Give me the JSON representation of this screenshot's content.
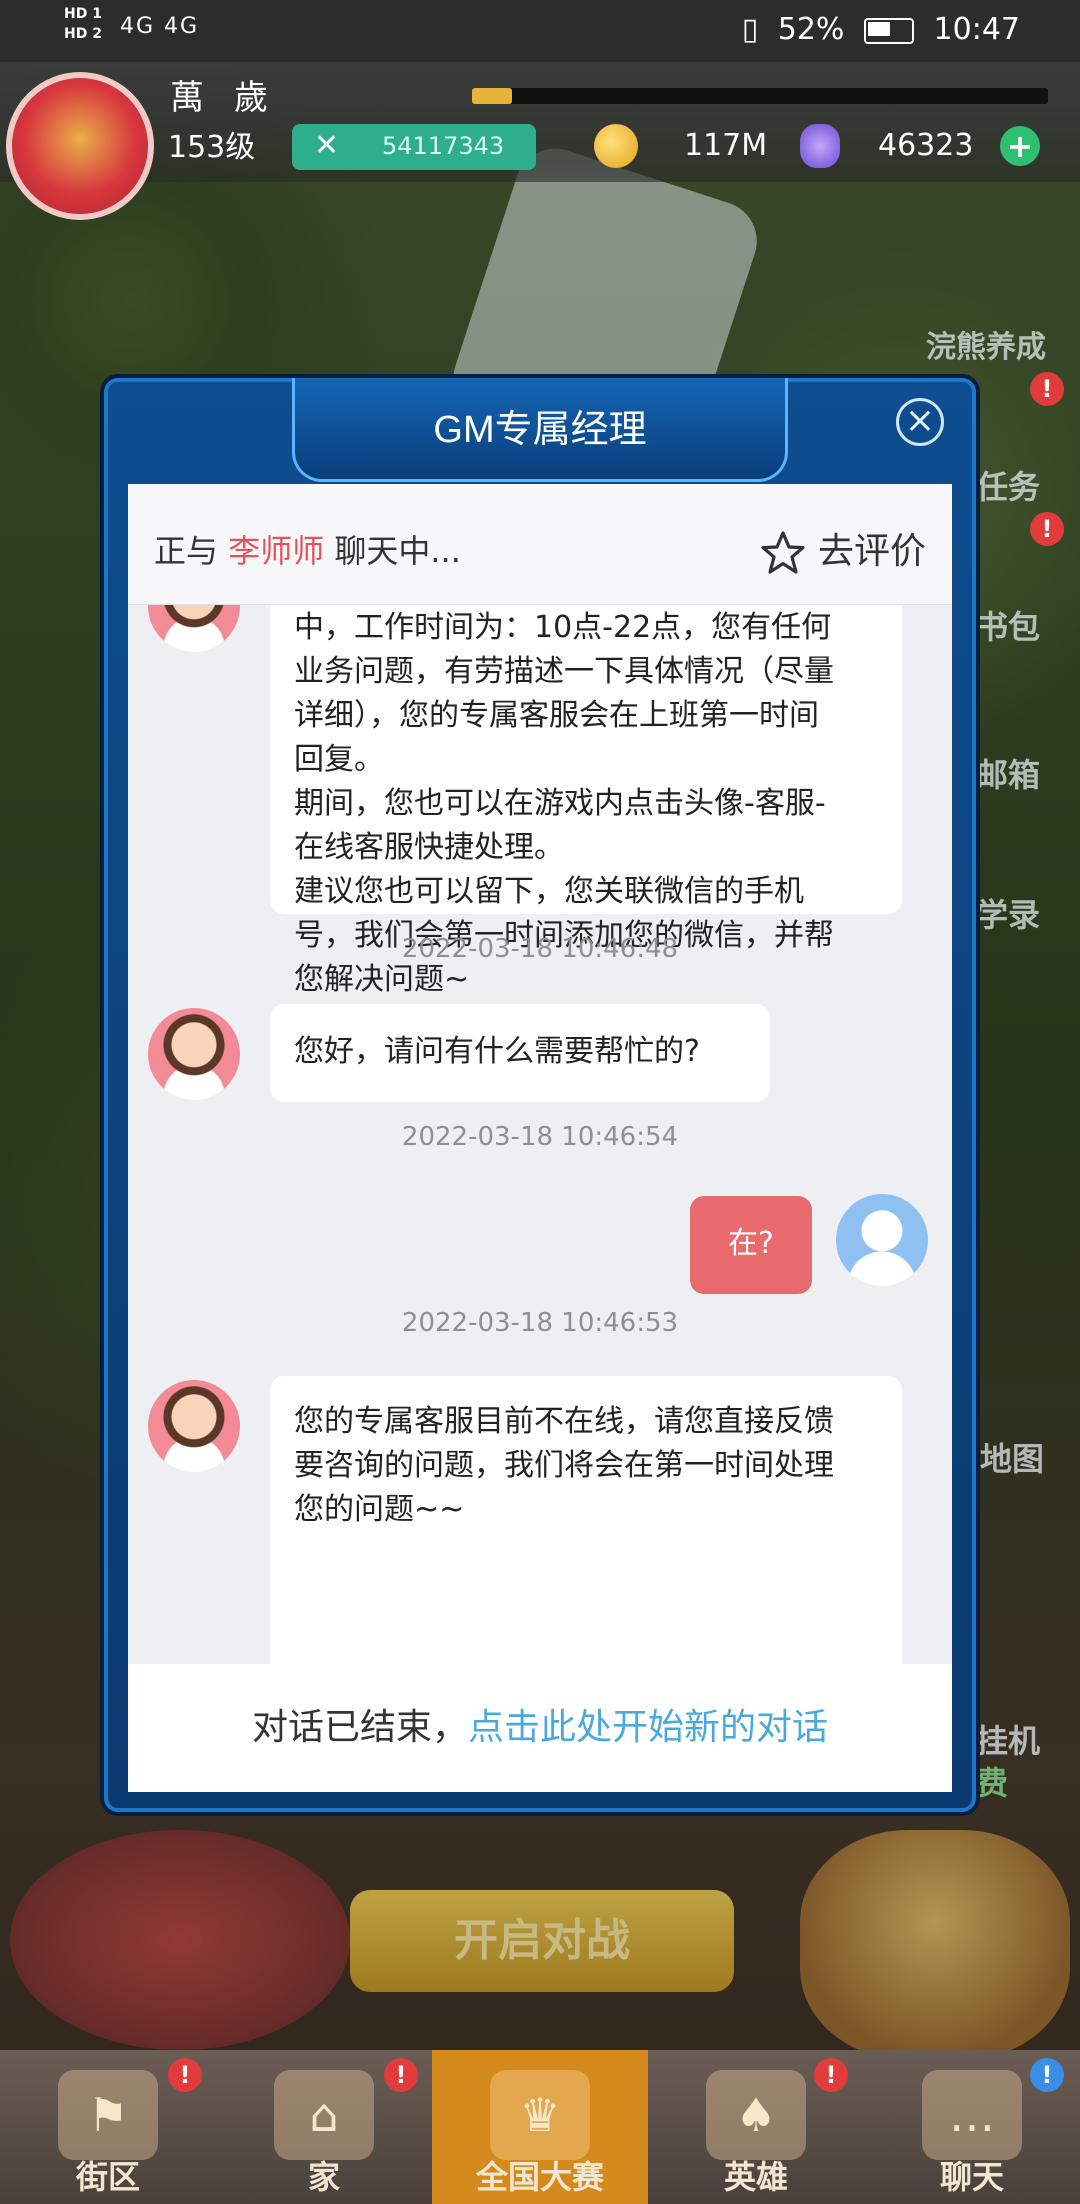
{
  "status_bar": {
    "sim_labels": [
      "HD 1",
      "HD 2"
    ],
    "signals": "4G 4G",
    "battery": "52%",
    "time": "10:47"
  },
  "hud": {
    "title": "萬歲",
    "level": "153级",
    "power": "54117343",
    "coins": "117M",
    "gems": "46323"
  },
  "side_menu": {
    "raccoon": "浣熊养成",
    "task": "任务",
    "bag": "书包",
    "mail": "邮箱",
    "study": "学录",
    "map": "地图",
    "idle": "挂机",
    "free": "费"
  },
  "dialog": {
    "title": "GM专属经理",
    "chat_with_prefix": "正与",
    "agent_name": "李师师",
    "chat_with_suffix": "聊天中...",
    "rate_label": "去评价",
    "footer_ended": "对话已结束，",
    "footer_link": "点击此处开始新的对话"
  },
  "messages": {
    "m1_lines": [
      "中，工作时间为：10点-22点，您有任何",
      "业务问题，有劳描述一下具体情况（尽量",
      "详细），您的专属客服会在上班第一时间",
      "回复。",
      "期间，您也可以在游戏内点击头像-客服-",
      "在线客服快捷处理。",
      "建议您也可以留下，您关联微信的手机",
      "号，我们会第一时间添加您的微信，并帮",
      "您解决问题~"
    ],
    "ts1": "2022-03-18 10:46:48",
    "m2": "您好，请问有什么需要帮忙的?",
    "ts2": "2022-03-18 10:46:54",
    "m3": "在?",
    "ts3": "2022-03-18 10:46:53",
    "m4_lines": [
      "您的专属客服目前不在线，请您直接反馈",
      "要咨询的问题，我们将会在第一时间处理",
      "您的问题~~"
    ]
  },
  "game_bottom": {
    "battle_button": "开启对战",
    "tabs": [
      "街区",
      "家",
      "全国大赛",
      "英雄",
      "聊天"
    ]
  },
  "colors": {
    "agent_name": "#e0555a",
    "link": "#4aa8dc",
    "my_bubble": "#e86a6d",
    "frame": "#0e4d8f"
  }
}
